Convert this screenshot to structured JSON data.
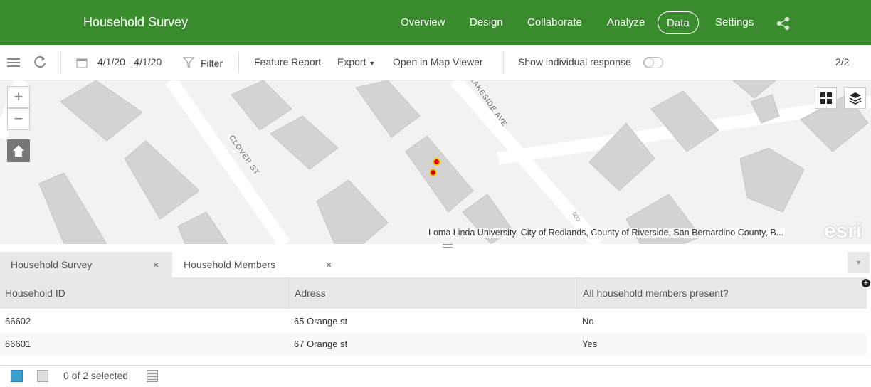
{
  "header": {
    "title": "Household Survey",
    "nav": [
      "Overview",
      "Design",
      "Collaborate",
      "Analyze",
      "Data",
      "Settings"
    ],
    "active": "Data",
    "accent": "#3a8a2e"
  },
  "toolbar": {
    "date_range": "4/1/20 - 4/1/20",
    "filter": "Filter",
    "feature_report": "Feature Report",
    "export": "Export",
    "open_map": "Open in Map Viewer",
    "show_individual": "Show individual response",
    "toggle_on": false,
    "page": "2/2"
  },
  "map": {
    "streets": [
      "CLOVER ST",
      "LAKESIDE AVE",
      "500"
    ],
    "attribution": "Loma Linda University, City of Redlands, County of Riverside, San Bernardino County, B...",
    "logo": "esri",
    "zoom_in": "+",
    "zoom_out": "−",
    "point_color": "#e00000"
  },
  "tabs": [
    {
      "label": "Household Survey",
      "close": "×"
    },
    {
      "label": "Household Members",
      "close": "×"
    }
  ],
  "table": {
    "columns": [
      "Household ID",
      "Adress",
      "All household members present?"
    ],
    "rows": [
      [
        "66602",
        "65 Orange st",
        "No"
      ],
      [
        "66601",
        "67 Orange st",
        "Yes"
      ]
    ]
  },
  "footer": {
    "selection": "0 of 2 selected"
  }
}
